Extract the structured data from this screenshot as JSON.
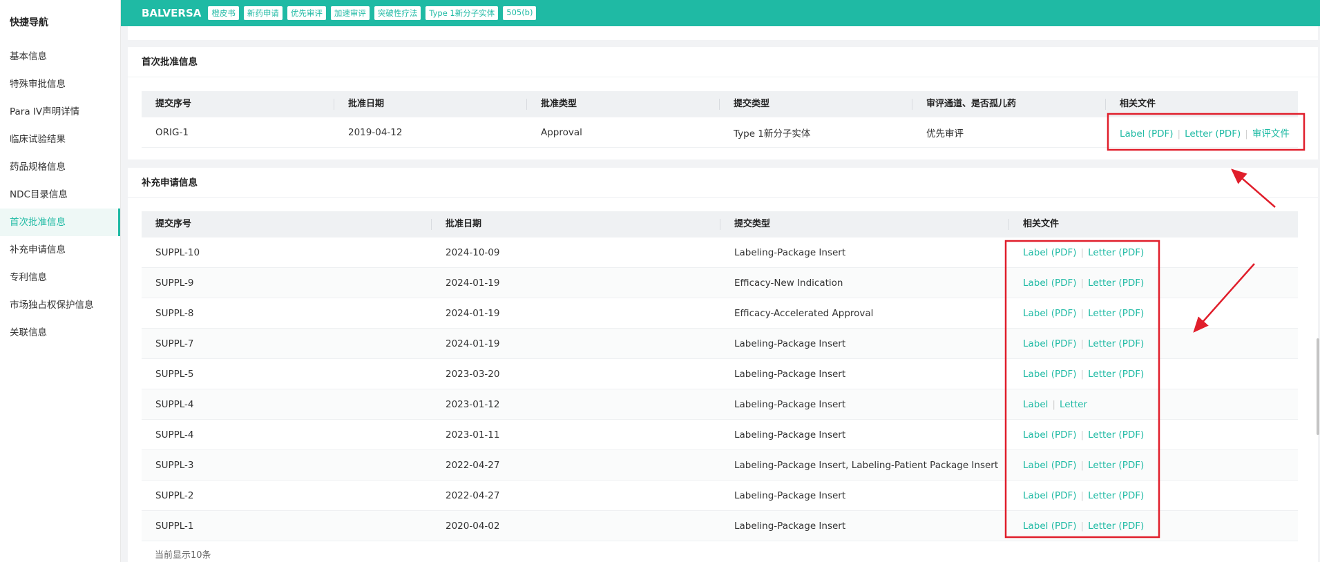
{
  "sidebar": {
    "title": "快捷导航",
    "items": [
      {
        "label": "基本信息"
      },
      {
        "label": "特殊审批信息"
      },
      {
        "label": "Para IV声明详情"
      },
      {
        "label": "临床试验结果"
      },
      {
        "label": "药品规格信息"
      },
      {
        "label": "NDC目录信息"
      },
      {
        "label": "首次批准信息",
        "active": true
      },
      {
        "label": "补充申请信息"
      },
      {
        "label": "专利信息"
      },
      {
        "label": "市场独占权保护信息"
      },
      {
        "label": "关联信息"
      }
    ]
  },
  "header": {
    "brand": "BALVERSA",
    "tags": [
      "橙皮书",
      "新药申请",
      "优先审评",
      "加速审评",
      "突破性疗法",
      "Type 1新分子实体",
      "505(b)"
    ]
  },
  "first_approval": {
    "title": "首次批准信息",
    "columns": [
      "提交序号",
      "批准日期",
      "批准类型",
      "提交类型",
      "审评通道、是否孤儿药",
      "相关文件"
    ],
    "row": {
      "submission": "ORIG-1",
      "date": "2019-04-12",
      "approval_type": "Approval",
      "submission_type": "Type 1新分子实体",
      "review": "优先审评",
      "files": [
        "Label (PDF)",
        "Letter (PDF)",
        "审评文件"
      ]
    }
  },
  "supplements": {
    "title": "补充申请信息",
    "columns": [
      "提交序号",
      "批准日期",
      "提交类型",
      "相关文件"
    ],
    "rows": [
      {
        "submission": "SUPPL-10",
        "date": "2024-10-09",
        "type": "Labeling-Package Insert",
        "files": [
          "Label (PDF)",
          "Letter (PDF)"
        ]
      },
      {
        "submission": "SUPPL-9",
        "date": "2024-01-19",
        "type": "Efficacy-New Indication",
        "files": [
          "Label (PDF)",
          "Letter (PDF)"
        ]
      },
      {
        "submission": "SUPPL-8",
        "date": "2024-01-19",
        "type": "Efficacy-Accelerated Approval",
        "files": [
          "Label (PDF)",
          "Letter (PDF)"
        ]
      },
      {
        "submission": "SUPPL-7",
        "date": "2024-01-19",
        "type": "Labeling-Package Insert",
        "files": [
          "Label (PDF)",
          "Letter (PDF)"
        ]
      },
      {
        "submission": "SUPPL-5",
        "date": "2023-03-20",
        "type": "Labeling-Package Insert",
        "files": [
          "Label (PDF)",
          "Letter (PDF)"
        ]
      },
      {
        "submission": "SUPPL-4",
        "date": "2023-01-12",
        "type": "Labeling-Package Insert",
        "files": [
          "Label",
          "Letter"
        ]
      },
      {
        "submission": "SUPPL-4",
        "date": "2023-01-11",
        "type": "Labeling-Package Insert",
        "files": [
          "Label (PDF)",
          "Letter (PDF)"
        ]
      },
      {
        "submission": "SUPPL-3",
        "date": "2022-04-27",
        "type": "Labeling-Package Insert, Labeling-Patient Package Insert",
        "files": [
          "Label (PDF)",
          "Letter (PDF)"
        ]
      },
      {
        "submission": "SUPPL-2",
        "date": "2022-04-27",
        "type": "Labeling-Package Insert",
        "files": [
          "Label (PDF)",
          "Letter (PDF)"
        ]
      },
      {
        "submission": "SUPPL-1",
        "date": "2020-04-02",
        "type": "Labeling-Package Insert",
        "files": [
          "Label (PDF)",
          "Letter (PDF)"
        ]
      }
    ],
    "footer": "当前显示10条"
  },
  "colors": {
    "accent": "#1fbaa4",
    "annotation": "#e01e2b"
  }
}
